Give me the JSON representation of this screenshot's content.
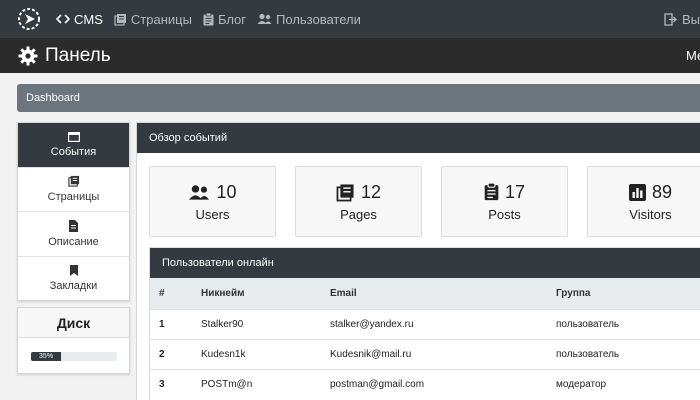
{
  "topnav": {
    "items": [
      {
        "label": "CMS",
        "icon": "code-icon"
      },
      {
        "label": "Страницы",
        "icon": "pages-icon"
      },
      {
        "label": "Блог",
        "icon": "clipboard-icon"
      },
      {
        "label": "Пользователи",
        "icon": "users-icon"
      }
    ],
    "right_label": "Вы"
  },
  "header": {
    "title": "Панель",
    "right_text": "Ме"
  },
  "breadcrumb": {
    "label": "Dashboard"
  },
  "sidemenu": {
    "items": [
      {
        "label": "События",
        "icon": "window-icon"
      },
      {
        "label": "Страницы",
        "icon": "pages-icon"
      },
      {
        "label": "Описание",
        "icon": "file-icon"
      },
      {
        "label": "Закладки",
        "icon": "bookmark-icon"
      }
    ]
  },
  "disk": {
    "title": "Диск",
    "percent_label": "35%",
    "percent": 35
  },
  "main": {
    "title": "Обзор событий"
  },
  "stats": [
    {
      "number": "10",
      "label": "Users",
      "icon": "users-icon"
    },
    {
      "number": "12",
      "label": "Pages",
      "icon": "pages-icon"
    },
    {
      "number": "17",
      "label": "Posts",
      "icon": "clipboard-icon"
    },
    {
      "number": "89",
      "label": "Visitors",
      "icon": "bar-chart-icon"
    }
  ],
  "users_panel": {
    "title": "Пользователи онлайн",
    "columns": [
      "#",
      "Никнейм",
      "Email",
      "Группа"
    ],
    "rows": [
      [
        "1",
        "Stalker90",
        "stalker@yandex.ru",
        "пользователь"
      ],
      [
        "2",
        "Kudesn1k",
        "Kudesnik@mail.ru",
        "пользователь"
      ],
      [
        "3",
        "POSTm@n",
        "postman@gmail.com",
        "модератор"
      ]
    ]
  },
  "colors": {
    "dark": "#343a40",
    "header": "#2b2b2b",
    "breadcrumb": "#6c757d",
    "nav_text": "#b5b9bd"
  }
}
